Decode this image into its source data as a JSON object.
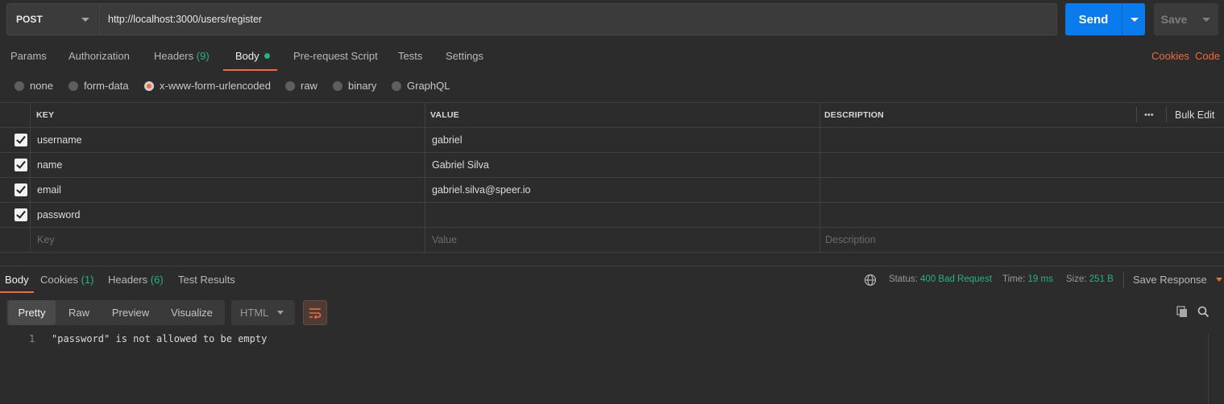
{
  "request": {
    "method": "POST",
    "url": "http://localhost:3000/users/register",
    "send_label": "Send",
    "save_label": "Save"
  },
  "request_tabs": {
    "params": "Params",
    "authorization": "Authorization",
    "headers": "Headers",
    "headers_count": "(9)",
    "body": "Body",
    "prerequest": "Pre-request Script",
    "tests": "Tests",
    "settings": "Settings",
    "cookies": "Cookies",
    "code": "Code"
  },
  "body_modes": {
    "none": "none",
    "form_data": "form-data",
    "urlencoded": "x-www-form-urlencoded",
    "raw": "raw",
    "binary": "binary",
    "graphql": "GraphQL",
    "selected": "x-www-form-urlencoded"
  },
  "params_table": {
    "headers": {
      "key": "KEY",
      "value": "VALUE",
      "description": "DESCRIPTION",
      "more": "•••",
      "bulk_edit": "Bulk Edit"
    },
    "rows": [
      {
        "checked": true,
        "key": "username",
        "value": "gabriel",
        "description": ""
      },
      {
        "checked": true,
        "key": "name",
        "value": "Gabriel Silva",
        "description": ""
      },
      {
        "checked": true,
        "key": "email",
        "value": "gabriel.silva@speer.io",
        "description": ""
      },
      {
        "checked": true,
        "key": "password",
        "value": "",
        "description": ""
      }
    ],
    "placeholders": {
      "key": "Key",
      "value": "Value",
      "description": "Description"
    }
  },
  "response_tabs": {
    "body": "Body",
    "cookies": "Cookies",
    "cookies_count": "(1)",
    "headers": "Headers",
    "headers_count": "(6)",
    "test_results": "Test Results"
  },
  "response_meta": {
    "status_label": "Status:",
    "status_value": "400 Bad Request",
    "time_label": "Time:",
    "time_value": "19 ms",
    "size_label": "Size:",
    "size_value": "251 B",
    "save_response": "Save Response"
  },
  "view_modes": {
    "pretty": "Pretty",
    "raw": "Raw",
    "preview": "Preview",
    "visualize": "Visualize",
    "format": "HTML"
  },
  "response_body": {
    "lines": [
      {
        "number": "1",
        "text": "\"password\" is not allowed to be empty"
      }
    ]
  },
  "colors": {
    "accent_orange": "#f26b3a",
    "send_blue": "#097bed",
    "success_green": "#26b47f",
    "background": "#2c2c2c"
  }
}
